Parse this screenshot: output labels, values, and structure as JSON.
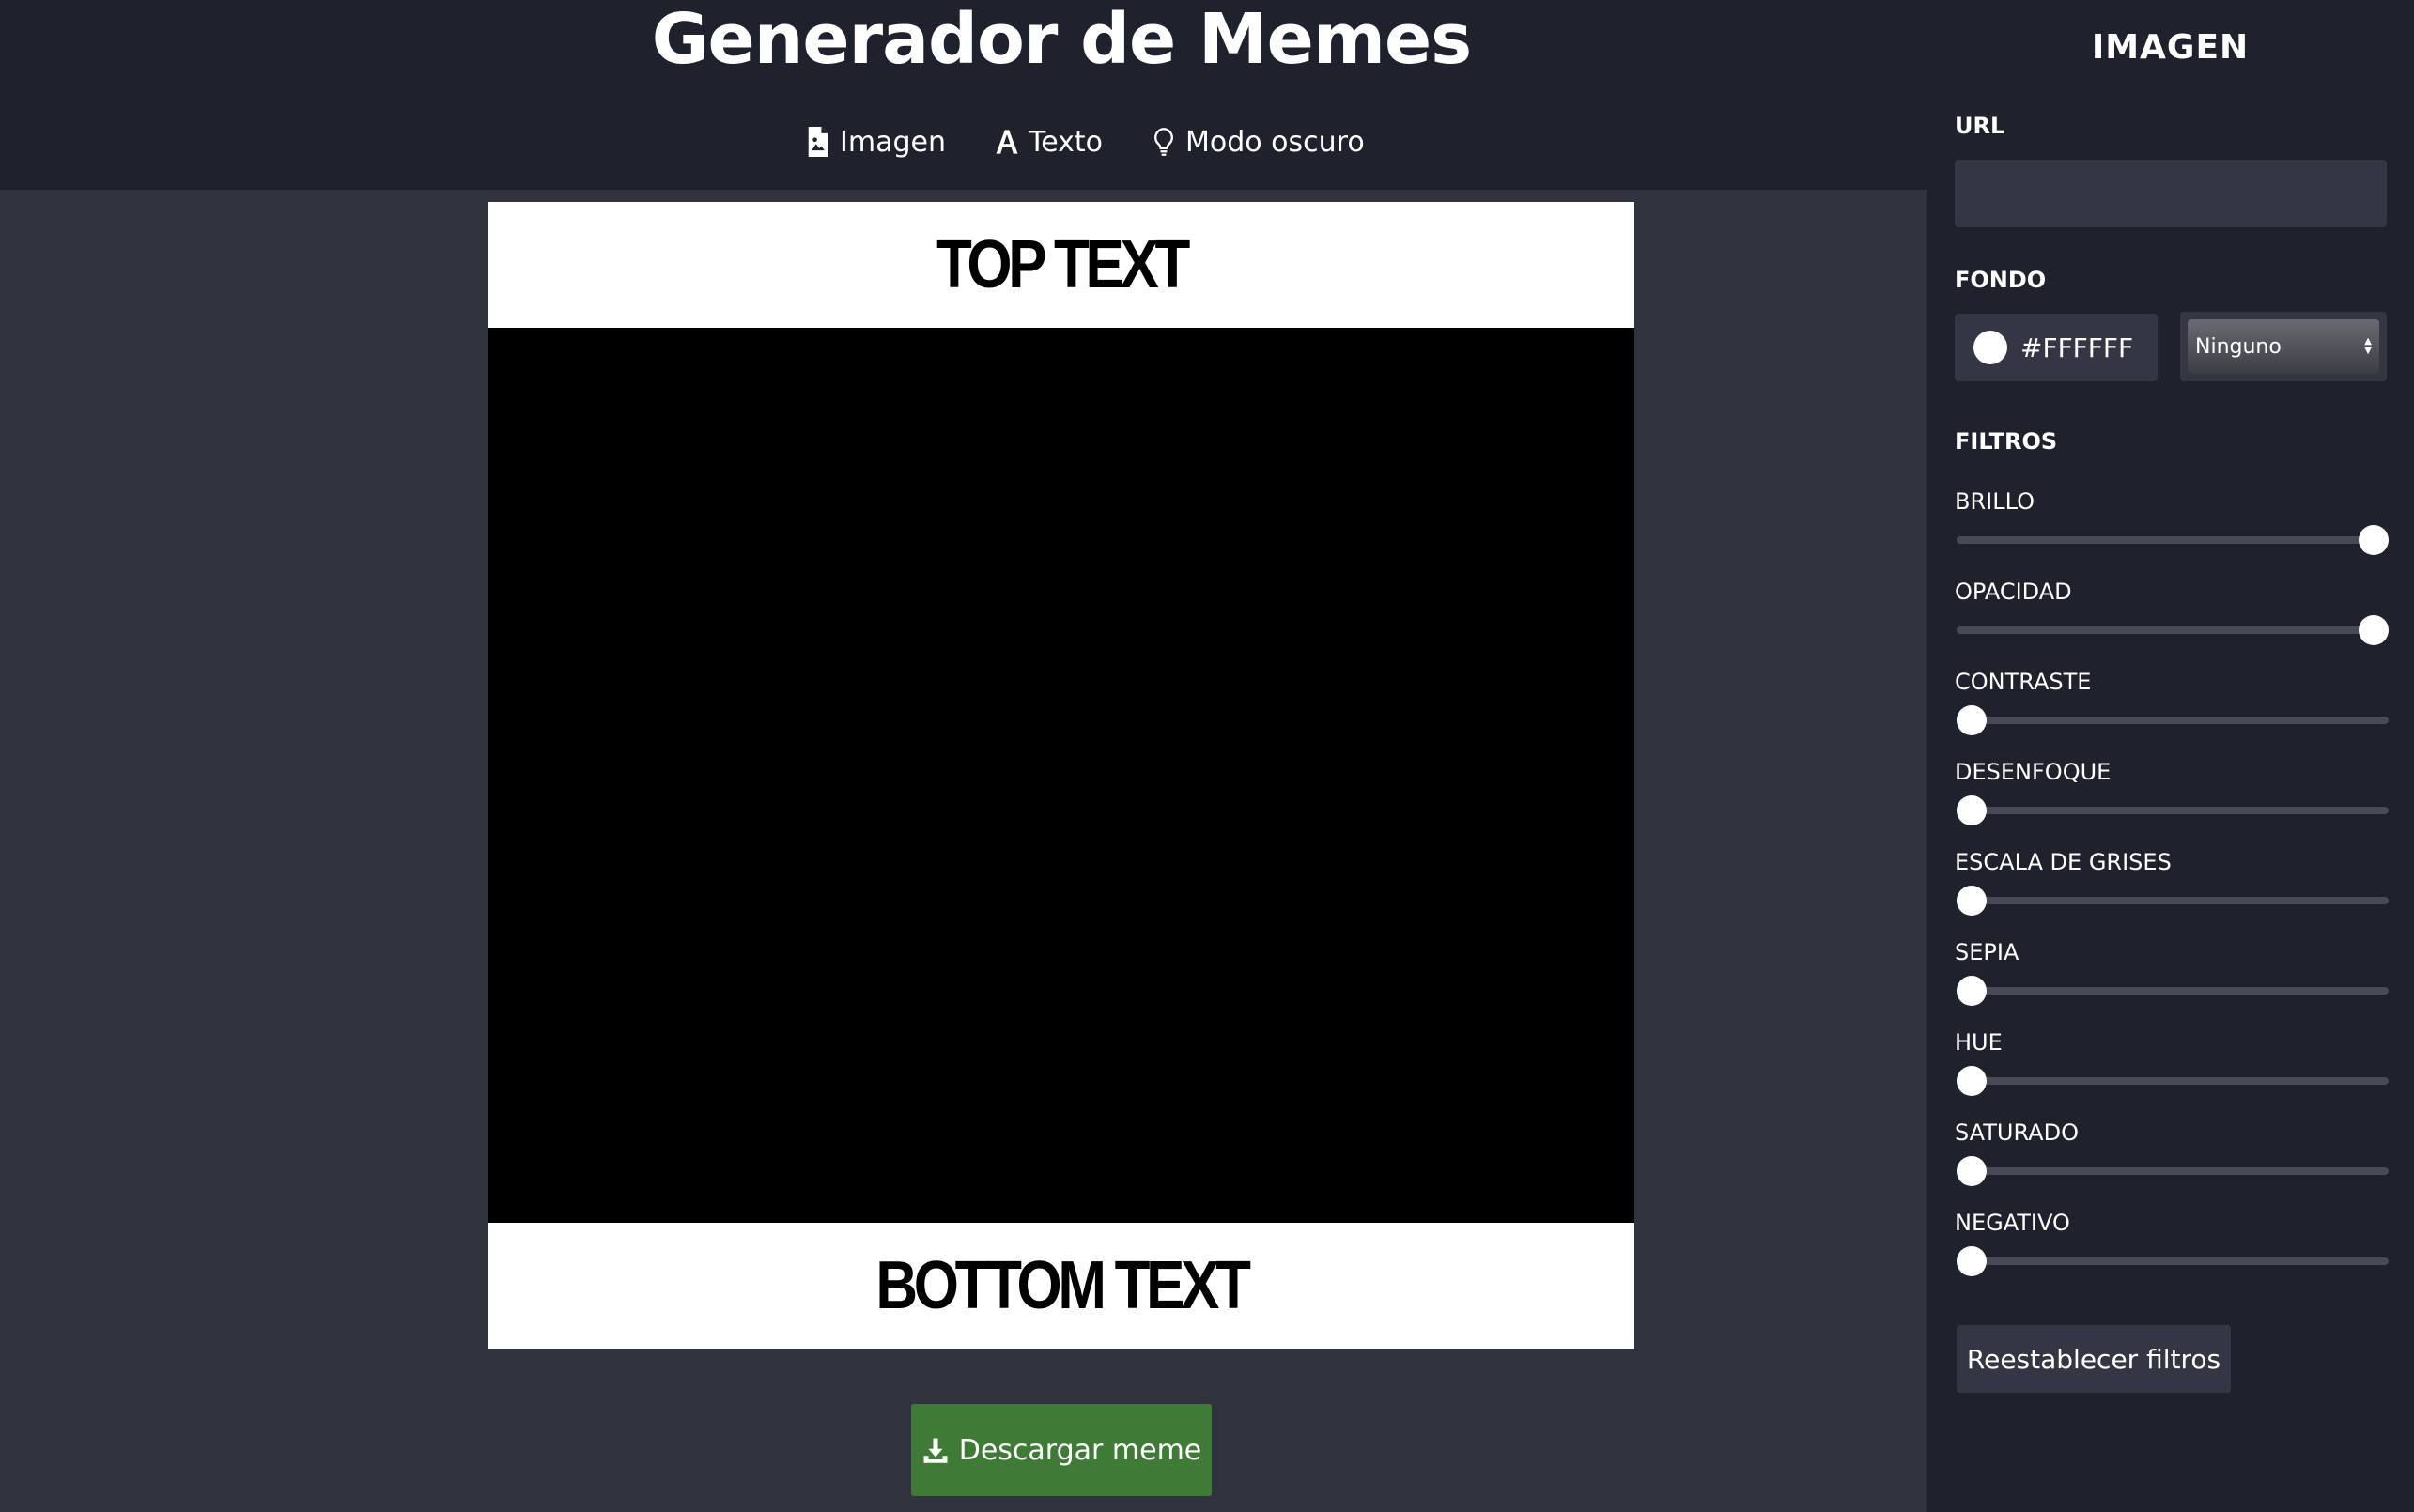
{
  "header": {
    "title": "Generador de Memes",
    "nav": [
      {
        "label": "Imagen",
        "icon": "image-file-icon"
      },
      {
        "label": "Texto",
        "icon": "font-icon"
      },
      {
        "label": "Modo oscuro",
        "icon": "lightbulb-icon"
      }
    ]
  },
  "meme": {
    "top_text": "TOP TEXT",
    "bottom_text": "BOTTOM TEXT",
    "image_background": "#000000",
    "caption_background": "#FFFFFF"
  },
  "download": {
    "label": "Descargar meme",
    "icon": "download-icon",
    "color": "#3f7b37"
  },
  "panel": {
    "title": "IMAGEN",
    "url_label": "URL",
    "url_value": "",
    "background_label": "FONDO",
    "background_color": "#FFFFFF",
    "blend_mode": "Ninguno",
    "filters_label": "FILTROS",
    "filters": [
      {
        "label": "BRILLO",
        "level": 1.0
      },
      {
        "label": "OPACIDAD",
        "level": 1.0
      },
      {
        "label": "CONTRASTE",
        "level": 0.0
      },
      {
        "label": "DESENFOQUE",
        "level": 0.0
      },
      {
        "label": "ESCALA DE GRISES",
        "level": 0.0
      },
      {
        "label": "SEPIA",
        "level": 0.0
      },
      {
        "label": "HUE",
        "level": 0.0
      },
      {
        "label": "SATURADO",
        "level": 0.0
      },
      {
        "label": "NEGATIVO",
        "level": 0.0
      }
    ],
    "reset_label": "Reestablecer filtros"
  }
}
